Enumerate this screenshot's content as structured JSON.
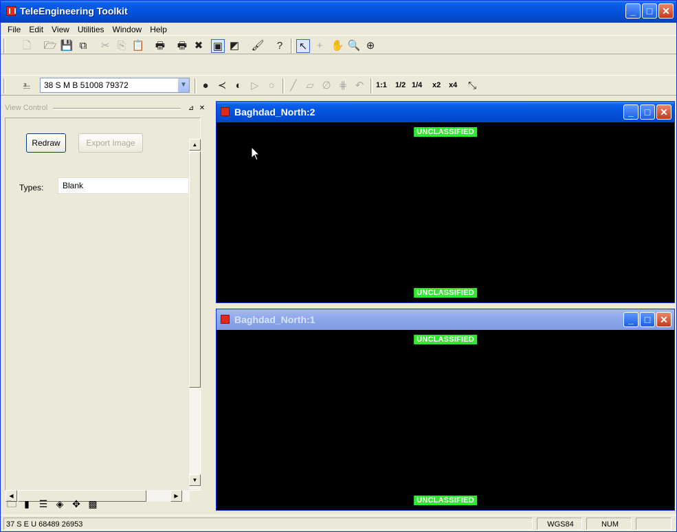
{
  "window": {
    "title": "TeleEngineering Toolkit",
    "min_glyph": "_",
    "max_glyph": "□",
    "close_glyph": "✕"
  },
  "menu": [
    "File",
    "Edit",
    "View",
    "Utilities",
    "Window",
    "Help"
  ],
  "nav_toolbar": {
    "coordinate": "38 S M B 51008 79372",
    "zoom_1_1": "1:1",
    "zoom_half": "1/2",
    "zoom_quarter": "1/4",
    "zoom_x2": "x2",
    "zoom_x4": "x4"
  },
  "view_control": {
    "header": "View Control",
    "redraw_label": "Redraw",
    "export_label": "Export Image",
    "types_label": "Types:",
    "types_value": "Blank"
  },
  "map_windows": [
    {
      "title": "Baghdad_North:2",
      "classification_top": "UNCLASSIFIED",
      "classification_bottom": "UNCLASSIFIED",
      "active": true
    },
    {
      "title": "Baghdad_North:1",
      "classification_top": "UNCLASSIFIED",
      "classification_bottom": "UNCLASSIFIED",
      "active": false
    }
  ],
  "status": {
    "coordinate": "37 S E U 68489 26953",
    "datum": "WGS84",
    "num": "NUM"
  },
  "colors": {
    "title_blue": "#0453dc",
    "classification_green": "#30e830",
    "map_background": "#000000"
  }
}
